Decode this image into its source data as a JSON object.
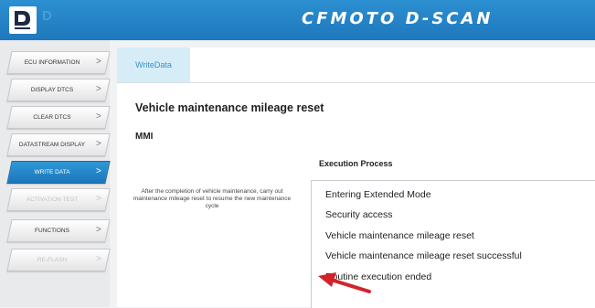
{
  "header": {
    "brand": "CFMOTO D-SCAN",
    "accent_color": "#2183c6",
    "logo_icon": "d-logo-icon"
  },
  "sidebar": {
    "items": [
      {
        "label": "ECU INFORMATION",
        "state": "normal"
      },
      {
        "label": "DISPLAY DTCS",
        "state": "normal"
      },
      {
        "label": "CLEAR DTCS",
        "state": "normal"
      },
      {
        "label": "DATASTREAM DISPLAY",
        "state": "normal"
      },
      {
        "label": "WRITE DATA",
        "state": "active"
      },
      {
        "label": "ACTIVATION TEST",
        "state": "disabled"
      },
      {
        "label": "FUNCTIONS",
        "state": "normal"
      },
      {
        "label": "RE-FLASH",
        "state": "disabled"
      }
    ],
    "chevron": ">"
  },
  "main": {
    "tab_label": "WriteData",
    "page_title": "Vehicle maintenance mileage reset",
    "ecu_code": "MMI",
    "process_label": "Execution Process",
    "description": "After the completion of vehicle maintenance, carry out maintenance mileage reset to resume the new maintenance cycle",
    "log_lines": [
      "Entering Extended Mode",
      "Security access",
      "Vehicle maintenance mileage reset",
      "Vehicle maintenance mileage reset successful",
      "Routine execution ended"
    ],
    "annotation_color": "#d3232a"
  }
}
